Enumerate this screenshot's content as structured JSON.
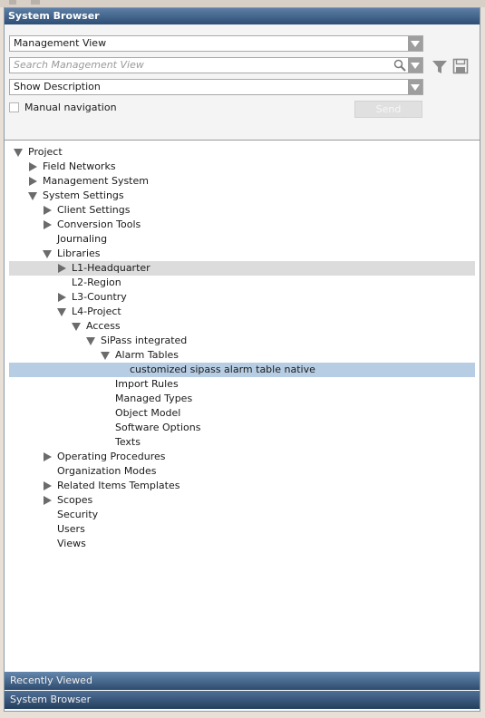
{
  "panel": {
    "title": "System Browser"
  },
  "controls": {
    "view_select": "Management View",
    "search_placeholder": "Search Management View",
    "description_select": "Show Description",
    "manual_nav_label": "Manual navigation",
    "send_label": "Send"
  },
  "tree": {
    "project": "Project",
    "field_networks": "Field Networks",
    "management_system": "Management System",
    "system_settings": "System Settings",
    "client_settings": "Client Settings",
    "conversion_tools": "Conversion Tools",
    "journaling": "Journaling",
    "libraries": "Libraries",
    "l1": "L1-Headquarter",
    "l2": "L2-Region",
    "l3": "L3-Country",
    "l4": "L4-Project",
    "access": "Access",
    "sipass": "SiPass integrated",
    "alarm_tables": "Alarm Tables",
    "customized": "customized sipass alarm table native",
    "import_rules": "Import Rules",
    "managed_types": "Managed Types",
    "object_model": "Object Model",
    "software_options": "Software Options",
    "texts": "Texts",
    "operating_procedures": "Operating Procedures",
    "organization_modes": "Organization Modes",
    "related_items": "Related Items Templates",
    "scopes": "Scopes",
    "security": "Security",
    "users": "Users",
    "views": "Views"
  },
  "bottom": {
    "recently_viewed": "Recently Viewed",
    "system_browser": "System Browser"
  },
  "colors": {
    "title_bar": "#2e4e74",
    "selection": "#b7cde4",
    "hover": "#dcdcdc"
  }
}
